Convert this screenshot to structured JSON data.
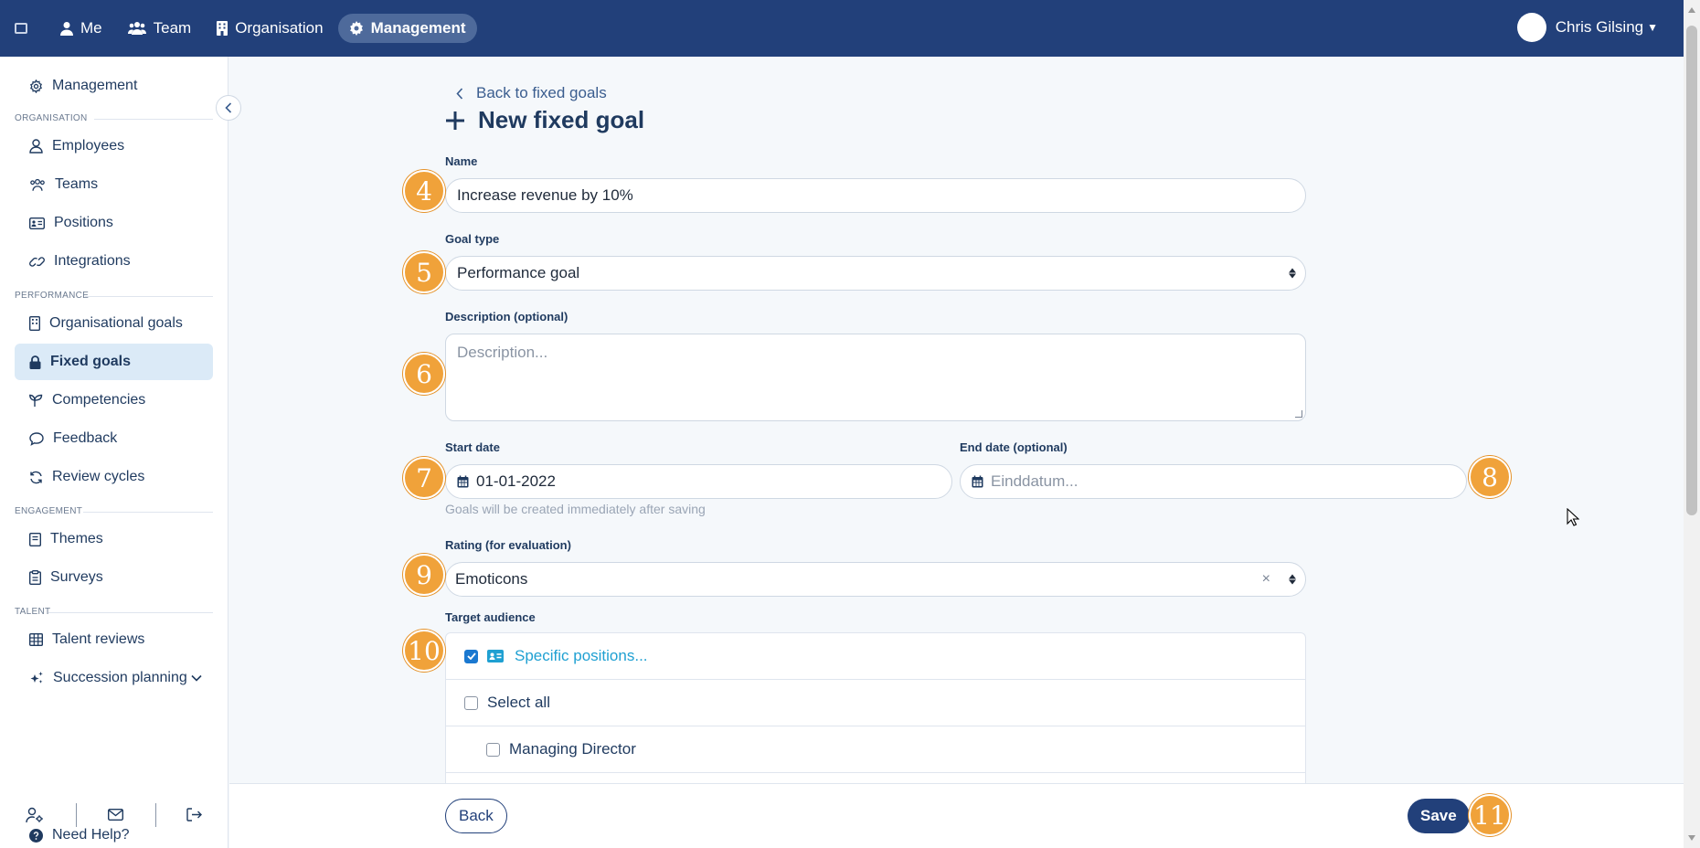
{
  "topnav": {
    "items": [
      {
        "label": "Me",
        "icon": "user-icon"
      },
      {
        "label": "Team",
        "icon": "team-icon"
      },
      {
        "label": "Organisation",
        "icon": "building-icon"
      },
      {
        "label": "Management",
        "icon": "gear-icon"
      }
    ],
    "user_name": "Chris Gilsing"
  },
  "sidebar": {
    "top": {
      "label": "Management",
      "icon": "gear-icon"
    },
    "sections": {
      "organisation": "ORGANISATION",
      "performance": "PERFORMANCE",
      "engagement": "ENGAGEMENT",
      "talent": "TALENT"
    },
    "items": {
      "employees": "Employees",
      "teams": "Teams",
      "positions": "Positions",
      "integrations": "Integrations",
      "organisational_goals": "Organisational goals",
      "fixed_goals": "Fixed goals",
      "competencies": "Competencies",
      "feedback": "Feedback",
      "review_cycles": "Review cycles",
      "themes": "Themes",
      "surveys": "Surveys",
      "talent_reviews": "Talent reviews",
      "succession_planning": "Succession planning"
    },
    "help": "Need Help?"
  },
  "page": {
    "back_link": "Back to fixed goals",
    "title": "New fixed goal"
  },
  "form": {
    "name": {
      "label": "Name",
      "value": "Increase revenue by 10%"
    },
    "goal_type": {
      "label": "Goal type",
      "value": "Performance goal"
    },
    "description": {
      "label": "Description (optional)",
      "placeholder": "Description..."
    },
    "start_date": {
      "label": "Start date",
      "value": "01-01-2022"
    },
    "end_date": {
      "label": "End date (optional)",
      "placeholder": "Einddatum..."
    },
    "date_help": "Goals will be created immediately after saving",
    "rating": {
      "label": "Rating (for evaluation)",
      "value": "Emoticons",
      "clear": "×"
    },
    "audience": {
      "label": "Target audience",
      "title": "Specific positions...",
      "select_all": "Select all",
      "items": [
        "Managing Director"
      ]
    }
  },
  "footer": {
    "back": "Back",
    "save": "Save"
  },
  "steps": [
    "4",
    "5",
    "6",
    "7",
    "8",
    "9",
    "10",
    "11"
  ],
  "colors": {
    "navbar": "#22407a",
    "accent": "#1fa0d2",
    "step_badge": "#f0a23a",
    "active_sidebar": "#dbeaf7"
  }
}
